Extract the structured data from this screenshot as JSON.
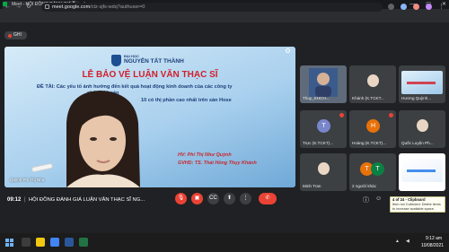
{
  "browser": {
    "tab_title": "Meet - HỘI ĐỒNG ĐÁNH GIÁ",
    "url_host": "meet.google.com",
    "url_path": "/ctz-sjfs-wdq?authuser=0"
  },
  "meeting": {
    "recording_label": "GHI",
    "time": "09:12",
    "title": "HỘI ĐỒNG ĐÁNH GIÁ LUẬN VĂN THẠC SĨ NG...",
    "presenter_name": "Quỳnh Phí Thị Như"
  },
  "slide": {
    "uni_line1": "ĐẠI HỌC",
    "uni_line2": "NGUYỄN TẤT THÀNH",
    "title": "LỄ BẢO VỆ LUẬN VĂN THẠC SĨ",
    "topic_line1": "ĐỀ TÀI: Các yếu tố ảnh hưởng đến kết quả hoạt động kinh doanh của các công ty",
    "topic_line2": "chứng khoán",
    "topic_line3": "10 có thị phần cao nhất trên sàn Hose",
    "student": "HV:  Phí Thị Như Quỳnh",
    "advisor": "GVHD: TS. Thái Hồng Thụy Khánh"
  },
  "tiles": [
    {
      "label": "Thuy_KHCH..."
    },
    {
      "label": "Khánh (K.TCKT..."
    },
    {
      "label": "Hương Quỳnh..."
    },
    {
      "label": "Trực (K.TCKT)..."
    },
    {
      "label": "Hoàng (K.TCKT)..."
    },
    {
      "label": "Quốc Luyện Ph..."
    },
    {
      "label": "Minh Tran"
    },
    {
      "label": "2 người khác"
    },
    {
      "label": ""
    }
  ],
  "avatars": {
    "truc": "T",
    "hoang": "H",
    "others1": "T",
    "others2": "T"
  },
  "toast": {
    "title": "4 of 24 - Clipboard",
    "body1": "Item not Collected: Delete items",
    "body2": "to increase available space."
  },
  "taskbar": {
    "time": "9:12 am",
    "date": "10/08/2021"
  },
  "colors": {
    "meet_bg": "#202124",
    "tile_bg": "#3c4043",
    "end_call": "#ea4335",
    "slide_title": "#d11f2a"
  }
}
